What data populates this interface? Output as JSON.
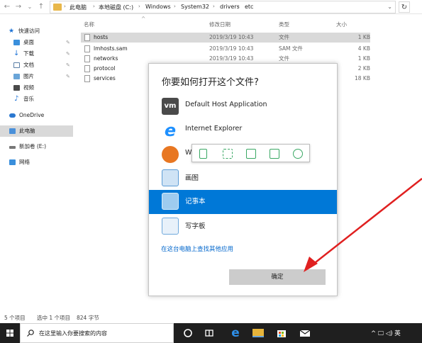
{
  "address_bar": {
    "back": "←",
    "forward": "→",
    "recent": "⌄",
    "up": "↑",
    "crumbs": [
      "此电脑",
      "本地磁盘 (C:)",
      "Windows",
      "System32",
      "drivers",
      "etc"
    ],
    "dropdown": "⌄",
    "refresh": "↻"
  },
  "nav_pane": {
    "items": [
      {
        "label": "快速访问",
        "icon": "star-icon"
      },
      {
        "label": "桌面",
        "icon": "desktop-icon"
      },
      {
        "label": "下载",
        "icon": "download-icon"
      },
      {
        "label": "文档",
        "icon": "document-icon"
      },
      {
        "label": "图片",
        "icon": "picture-icon"
      },
      {
        "label": "视频",
        "icon": "video-icon"
      },
      {
        "label": "音乐",
        "icon": "music-icon"
      },
      {
        "label": "OneDrive",
        "icon": "cloud-icon"
      },
      {
        "label": "此电脑",
        "icon": "computer-icon"
      },
      {
        "label": "新加卷 (E:)",
        "icon": "drive-icon"
      },
      {
        "label": "网络",
        "icon": "network-icon"
      }
    ],
    "pin": "📌"
  },
  "file_list": {
    "sort_indicator": "^",
    "columns": [
      "名称",
      "修改日期",
      "类型",
      "大小"
    ],
    "rows": [
      {
        "name": "hosts",
        "date": "2019/3/19 10:43",
        "type": "文件",
        "size": "1 KB"
      },
      {
        "name": "lmhosts.sam",
        "date": "2019/3/19 10:43",
        "type": "SAM 文件",
        "size": "4 KB"
      },
      {
        "name": "networks",
        "date": "2019/3/19 10:43",
        "type": "文件",
        "size": "1 KB"
      },
      {
        "name": "protocol",
        "date": "",
        "type": "",
        "size": "2 KB"
      },
      {
        "name": "services",
        "date": "",
        "type": "",
        "size": "18 KB"
      }
    ]
  },
  "status_bar": {
    "count": "5 个项目",
    "selected": "选中 1 个项目",
    "size": "824 字节"
  },
  "dialog": {
    "title": "你要如何打开这个文件?",
    "apps": [
      {
        "label": "Default Host Application",
        "icon": "vm-icon",
        "icon_text": "vm",
        "color": "#4a4a4a"
      },
      {
        "label": "Internet Explorer",
        "icon": "internet-explorer-icon",
        "color": "#1e90ff"
      },
      {
        "label": "W",
        "icon": "media-player-icon",
        "color": "#e87722"
      },
      {
        "label": "画图",
        "icon": "paint-icon",
        "color": "#5b9bd5"
      },
      {
        "label": "记事本",
        "icon": "notepad-icon",
        "color": "#9ecbef"
      },
      {
        "label": "写字板",
        "icon": "wordpad-icon",
        "color": "#6fa8dc"
      }
    ],
    "more_apps_link": "在这台电脑上查找其他应用",
    "ok_button": "确定",
    "selected_color": "#0078d7"
  },
  "floating_toolbar": {
    "buttons": [
      "phone-icon",
      "expand-icon",
      "save-icon",
      "share-icon",
      "settings-icon"
    ],
    "accent": "#3aa864"
  },
  "taskbar": {
    "search_placeholder": "在这里输入你要搜索的内容",
    "tray": "^ 🖵 ◁) 英"
  }
}
